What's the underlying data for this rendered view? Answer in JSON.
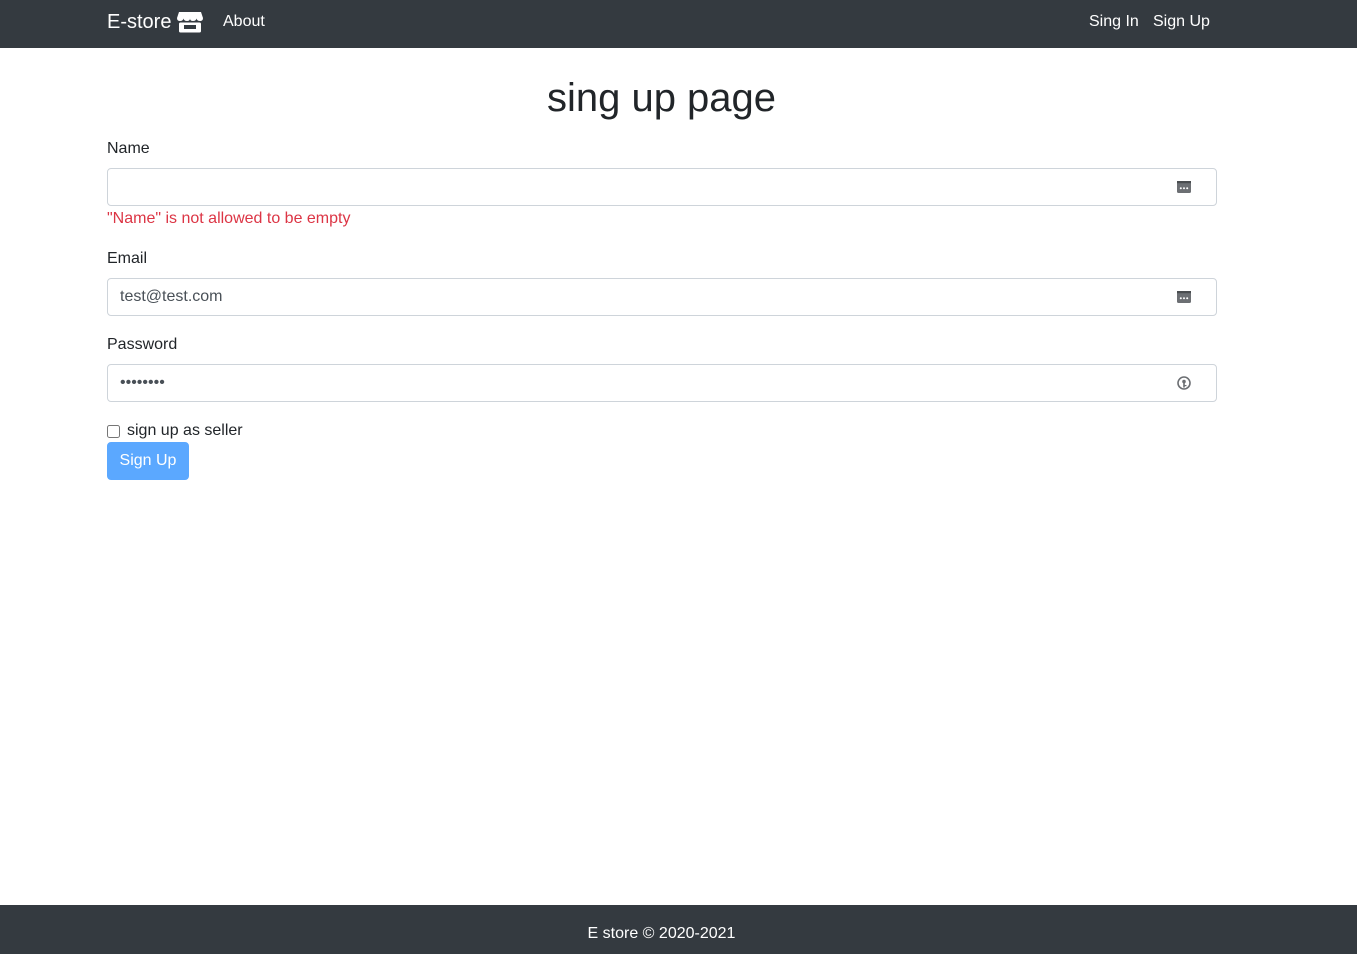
{
  "navbar": {
    "brand": "E-store",
    "brand_icon": "store-icon",
    "about": "About",
    "sign_in": "Sing In",
    "sign_up": "Sign Up",
    "background": "#343a40"
  },
  "form": {
    "title": "sing up page",
    "name": {
      "label": "Name",
      "value": "",
      "error": "\"Name\" is not allowed to be empty",
      "icon": "autofill-menu-icon"
    },
    "email": {
      "label": "Email",
      "value": "test@test.com",
      "icon": "autofill-menu-icon"
    },
    "password": {
      "label": "Password",
      "value": "••••••••",
      "icon": "key-icon"
    },
    "seller_checkbox": {
      "label": "sign up as seller",
      "checked": false
    },
    "submit": "Sign Up"
  },
  "footer": {
    "text": "E store © 2020-2021"
  },
  "colors": {
    "dark": "#343a40",
    "error": "#dc3545",
    "primary_button": "#5ba8ff"
  }
}
